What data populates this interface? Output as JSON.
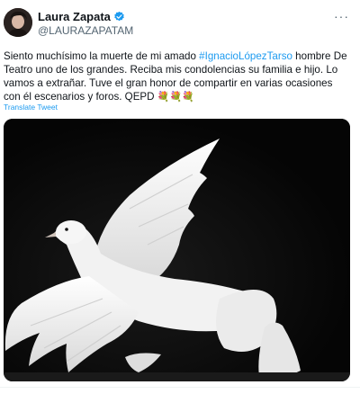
{
  "author": {
    "name": "Laura Zapata",
    "handle": "@LAURAZAPATAM"
  },
  "tweet": {
    "text_before_hashtag": "Siento muchísimo la muerte de mi amado ",
    "hashtag": "#IgnacioLópezTarso",
    "text_after_hashtag": " hombre De Teatro uno de los grandes. Reciba mis condolencias su familia e hijo. Lo vamos a extrañar. Tuve el gran honor de compartir en varias ocasiones con él escenarios y foros. QEPD ",
    "emoji": "💐💐💐"
  },
  "translate_label": "Translate Tweet",
  "more_label": "···",
  "colors": {
    "link": "#1d9bf0",
    "verified": "#1d9bf0",
    "text": "#0f1419",
    "muted": "#536471"
  },
  "icons": {
    "verified": "verified-badge-icon",
    "more": "more-options-icon"
  }
}
